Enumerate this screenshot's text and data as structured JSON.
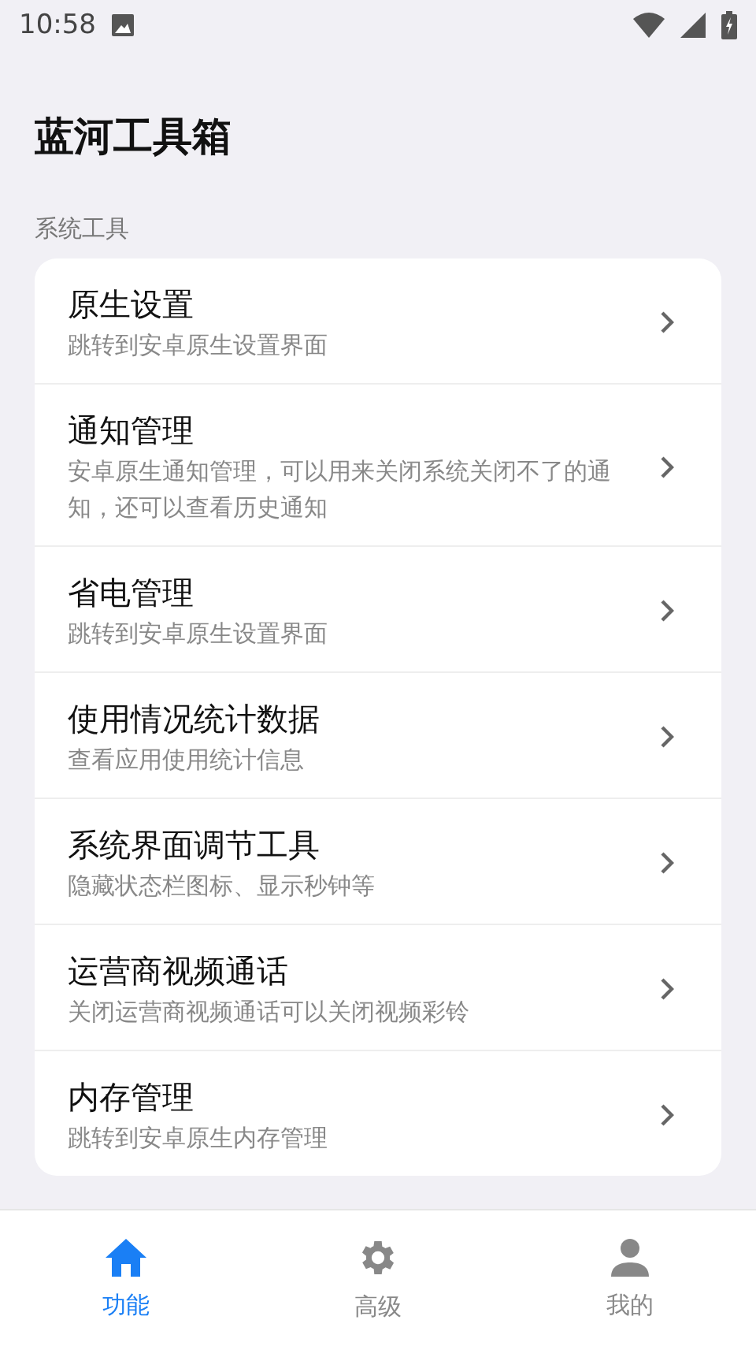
{
  "status_bar": {
    "time": "10:58"
  },
  "title": "蓝河工具箱",
  "section": {
    "label": "系统工具",
    "items": [
      {
        "title": "原生设置",
        "subtitle": "跳转到安卓原生设置界面"
      },
      {
        "title": "通知管理",
        "subtitle": "安卓原生通知管理，可以用来关闭系统关闭不了的通知，还可以查看历史通知"
      },
      {
        "title": "省电管理",
        "subtitle": "跳转到安卓原生设置界面"
      },
      {
        "title": "使用情况统计数据",
        "subtitle": "查看应用使用统计信息"
      },
      {
        "title": "系统界面调节工具",
        "subtitle": "隐藏状态栏图标、显示秒钟等"
      },
      {
        "title": "运营商视频通话",
        "subtitle": "关闭运营商视频通话可以关闭视频彩铃"
      },
      {
        "title": "内存管理",
        "subtitle": "跳转到安卓原生内存管理"
      }
    ]
  },
  "bottom_nav": [
    {
      "label": "功能",
      "kind": "home",
      "selected": true
    },
    {
      "label": "高级",
      "kind": "gear",
      "selected": false
    },
    {
      "label": "我的",
      "kind": "person",
      "selected": false
    }
  ]
}
